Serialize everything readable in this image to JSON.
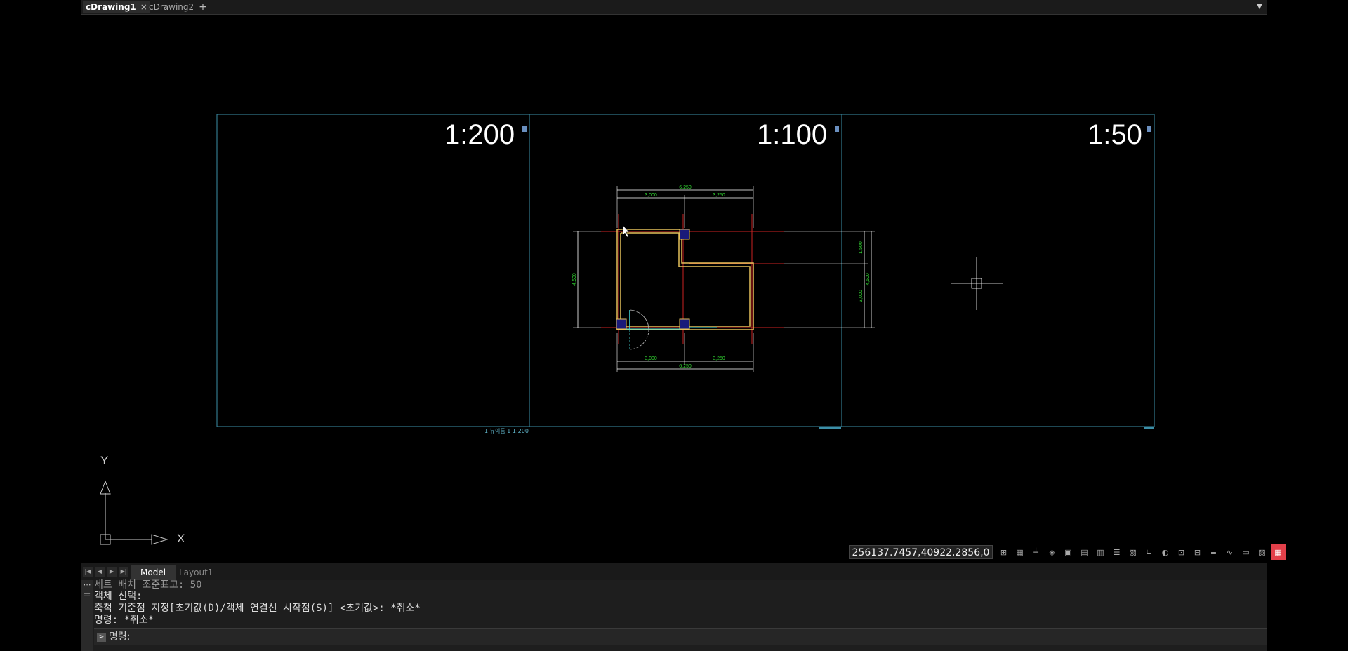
{
  "tabs": [
    {
      "label": "cDrawing1",
      "active": true
    },
    {
      "label": "cDrawing2",
      "active": false
    }
  ],
  "tab_close": "×",
  "tab_add": "+",
  "viewports": [
    {
      "scale": "1:200",
      "caption": "1 뷰이름 1 1:200"
    },
    {
      "scale": "1:100",
      "caption": ""
    },
    {
      "scale": "1:50",
      "caption": ""
    }
  ],
  "dimensions": {
    "top_total": "6,250",
    "top_left": "3,000",
    "top_right": "3,250",
    "bottom_total": "6,250",
    "bottom_left": "3,000",
    "bottom_right": "3,250",
    "left_total": "4,500",
    "right_upper": "1,500",
    "right_lower": "3,000",
    "right_total": "4,500"
  },
  "ucs": {
    "x_label": "X",
    "y_label": "Y"
  },
  "coordinates": "256137.7457,40922.2856,0",
  "layout_tabs": {
    "model": "Model",
    "layout1": "Layout1"
  },
  "command_history": [
    "세트 배치 조준표고: 50",
    "객체 선택:",
    "축척 기준점 지정[초기값(D)/객체 연결선 시작점(S)] <초기값>: *취소*",
    "명령: *취소*"
  ],
  "command_prompt": "명령:",
  "colors": {
    "accent_red": "#e2404a",
    "viewport_border": "#3c8fa8",
    "wall": "#e6c15a",
    "dim": "#33dd33",
    "axis_red": "#cc2222"
  }
}
